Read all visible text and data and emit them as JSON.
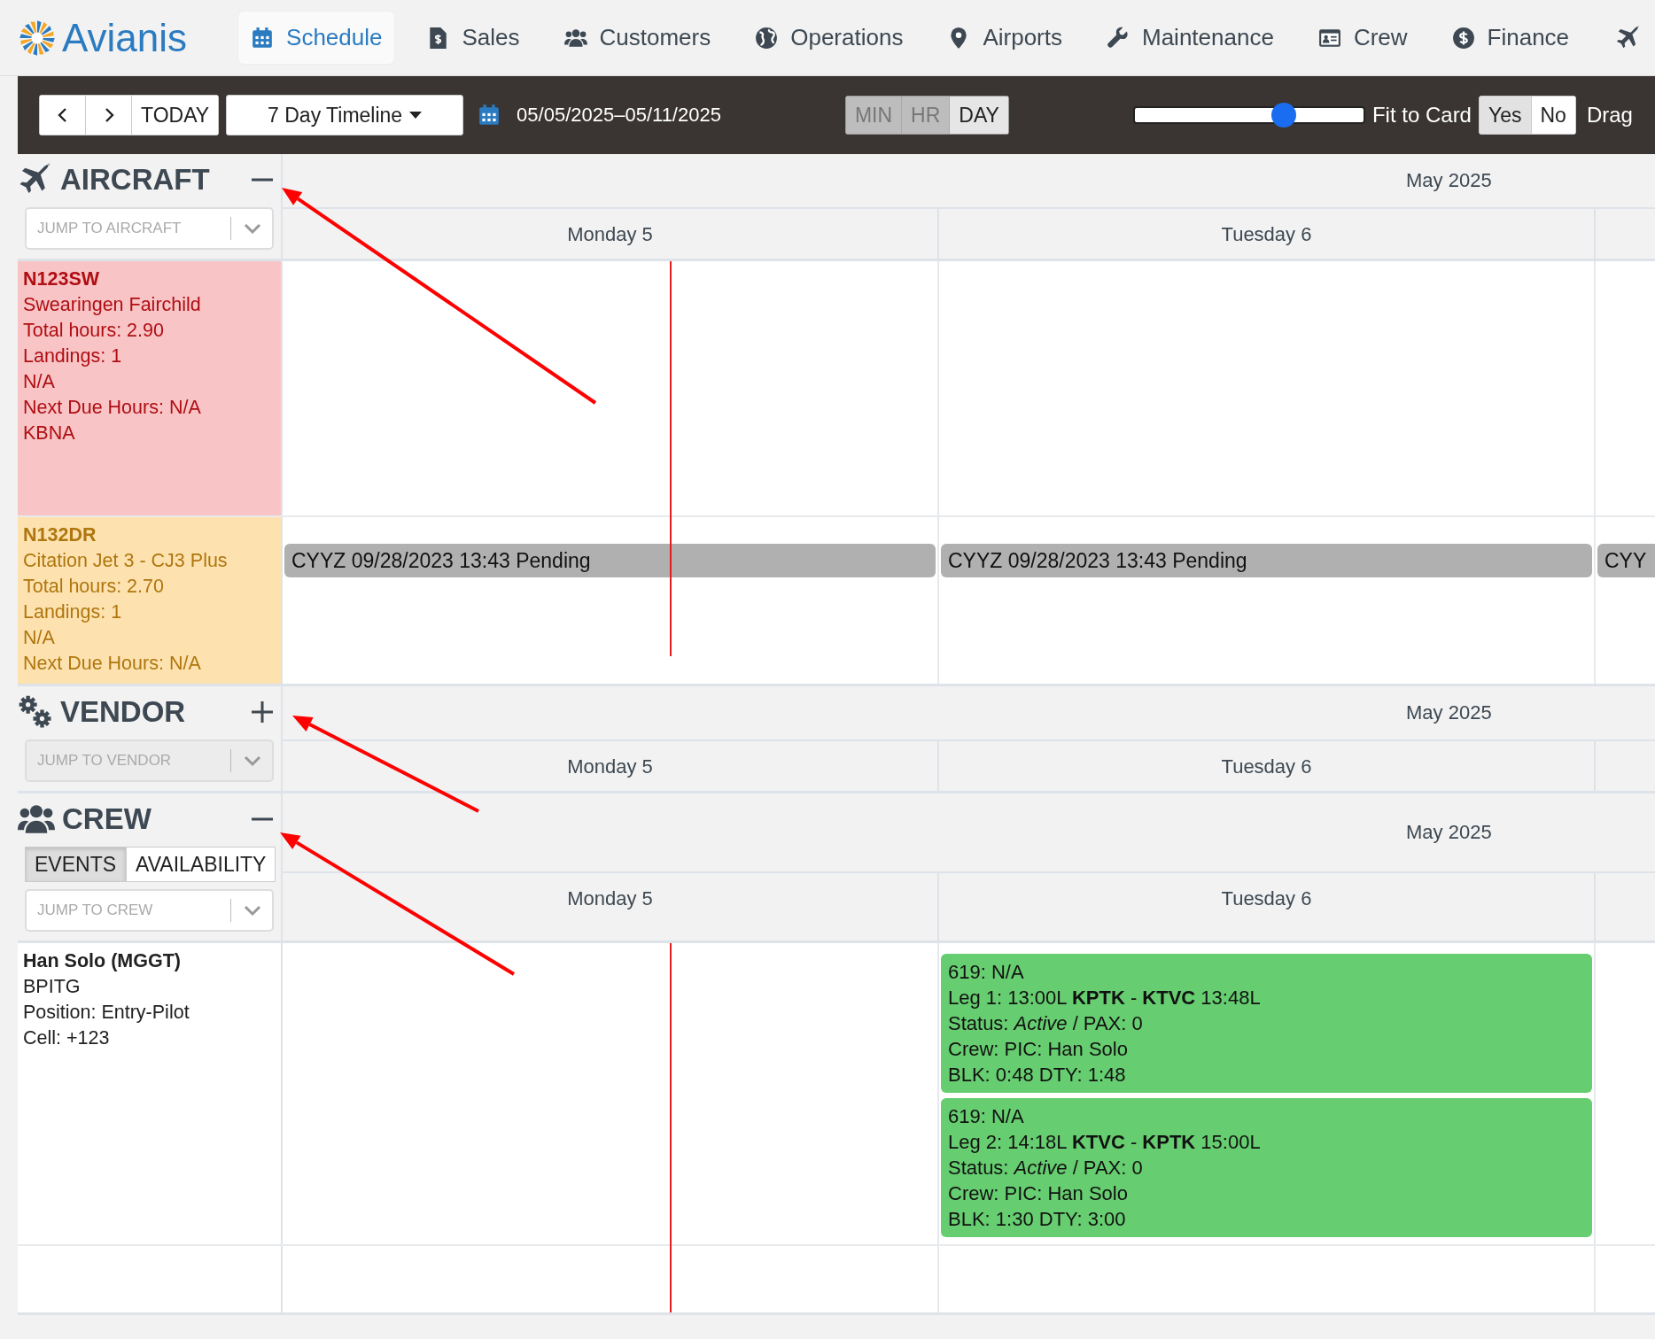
{
  "brand": {
    "name": "Avianis"
  },
  "nav": [
    {
      "label": "Schedule",
      "selected": true
    },
    {
      "label": "Sales",
      "selected": false
    },
    {
      "label": "Customers",
      "selected": false
    },
    {
      "label": "Operations",
      "selected": false
    },
    {
      "label": "Airports",
      "selected": false
    },
    {
      "label": "Maintenance",
      "selected": false
    },
    {
      "label": "Crew",
      "selected": false
    },
    {
      "label": "Finance",
      "selected": false
    }
  ],
  "toolbar": {
    "today": "TODAY",
    "view": "7 Day Timeline",
    "date_range": "05/05/2025–05/11/2025",
    "scale": [
      {
        "label": "MIN",
        "selected": false
      },
      {
        "label": "HR",
        "selected": false
      },
      {
        "label": "DAY",
        "selected": true
      }
    ],
    "zoom": {
      "level": 0.65
    },
    "fit_label": "Fit to Card",
    "fit_options": [
      {
        "label": "Yes",
        "selected": true
      },
      {
        "label": "No",
        "selected": false
      }
    ],
    "drag_label": "Drag"
  },
  "sections": [
    {
      "kind": "aircraft",
      "title": "AIRCRAFT",
      "expanded": true,
      "jump_placeholder": "JUMP TO AIRCRAFT",
      "jump_disabled": false,
      "month": "May 2025",
      "days": [
        "Monday 5",
        "Tuesday 6"
      ],
      "rows": [
        {
          "title": "N123SW",
          "lines": [
            "Swearingen Fairchild",
            "Total hours: 2.90",
            "Landings: 1",
            "N/A",
            "Next Due Hours: N/A",
            "KBNA"
          ],
          "color": "#f8c4c6"
        },
        {
          "title": "N132DR",
          "lines": [
            "Citation Jet 3 - CJ3 Plus",
            "Total hours: 2.70",
            "Landings: 1",
            "N/A",
            "Next Due Hours: N/A"
          ],
          "color": "#fde2b0",
          "cells": [
            {
              "events": [
                {
                  "kind": "bar",
                  "lines": [
                    "CYYZ 09/28/2023 13:43 Pending"
                  ]
                }
              ]
            },
            {
              "events": [
                {
                  "kind": "bar",
                  "lines": [
                    "CYYZ 09/28/2023 13:43 Pending"
                  ]
                }
              ]
            },
            {
              "events": [
                {
                  "kind": "bar",
                  "lines": [
                    "CYY"
                  ]
                }
              ]
            }
          ]
        }
      ]
    },
    {
      "kind": "vendor",
      "title": "VENDOR",
      "expanded": false,
      "jump_placeholder": "JUMP TO VENDOR",
      "jump_disabled": true,
      "month": "May 2025",
      "days": [
        "Monday 5",
        "Tuesday 6"
      ]
    },
    {
      "kind": "crew",
      "title": "CREW",
      "expanded": true,
      "tabs": [
        {
          "label": "EVENTS",
          "selected": true
        },
        {
          "label": "AVAILABILITY",
          "selected": false
        }
      ],
      "jump_placeholder": "JUMP TO CREW",
      "jump_disabled": false,
      "month": "May 2025",
      "days": [
        "Monday 5",
        "Tuesday 6"
      ],
      "rows": [
        {
          "title": "Han Solo (MGGT)",
          "lines": [
            "BPITG",
            "Position: Entry-Pilot",
            "Cell: +123"
          ],
          "cells": [
            {},
            {
              "events": [
                {
                  "kind": "card",
                  "lines": [
                    "619: N/A",
                    "Leg 1: 13:00L **KPTK** - **KTVC** 13:48L",
                    "Status: *Active* / PAX: 0",
                    "Crew: PIC: Han Solo",
                    "BLK: 0:48 DTY: 1:48"
                  ]
                },
                {
                  "kind": "card",
                  "lines": [
                    "619: N/A",
                    "Leg 2: 14:18L **KTVC** - **KPTK** 15:00L",
                    "Status: *Active* / PAX: 0",
                    "Crew: PIC: Han Solo",
                    "BLK: 1:30 DTY: 3:00"
                  ]
                }
              ]
            }
          ]
        }
      ]
    }
  ]
}
